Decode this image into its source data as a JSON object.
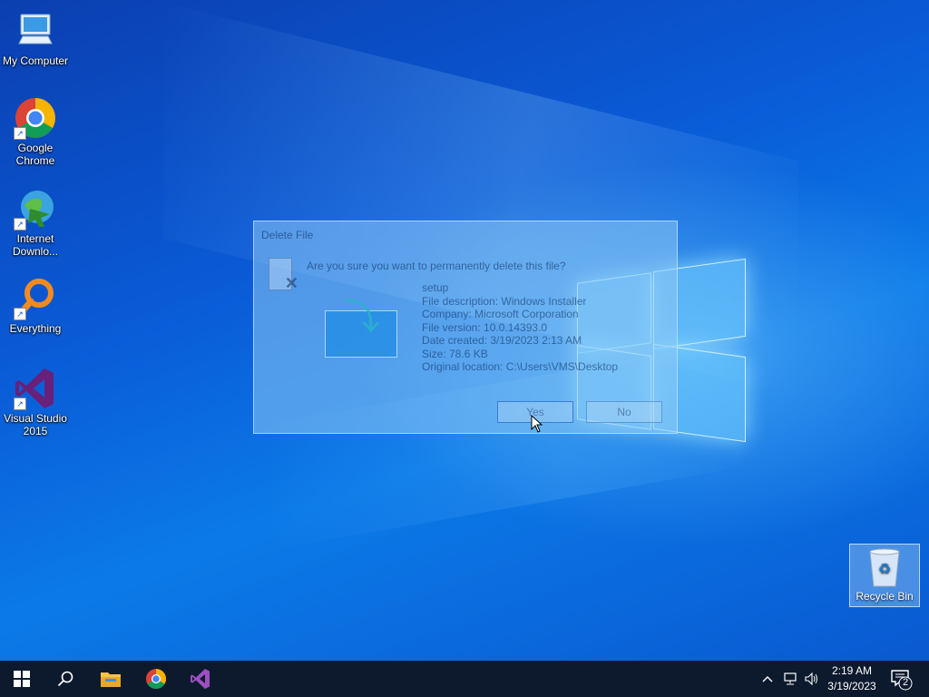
{
  "desktop": {
    "icons": [
      {
        "label": "My Computer"
      },
      {
        "label": "Google Chrome"
      },
      {
        "label": "Internet Downlo..."
      },
      {
        "label": "Everything"
      },
      {
        "label": "Visual Studio 2015"
      }
    ],
    "recycle_bin": {
      "label": "Recycle Bin"
    }
  },
  "dialog": {
    "title": "Delete File",
    "question": "Are you sure you want to permanently delete this file?",
    "file_name": "setup",
    "description": "File description: Windows Installer",
    "company": "Company: Microsoft Corporation",
    "version": "File version: 10.0.14393.0",
    "date_created": "Date created: 3/19/2023 2:13 AM",
    "size": "Size: 78.6 KB",
    "location": "Original location: C:\\Users\\VMS\\Desktop",
    "yes_label": "Yes",
    "no_label": "No"
  },
  "taskbar": {
    "time": "2:19 AM",
    "date": "3/19/2023",
    "notification_count": "2"
  }
}
